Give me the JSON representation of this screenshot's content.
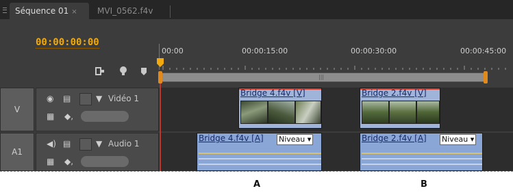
{
  "tabs": [
    {
      "label": "Séquence 01",
      "close": "×",
      "active": true
    },
    {
      "label": "MVI_0562.f4v",
      "active": false
    }
  ],
  "timecode": "00:00:00:00",
  "ruler": {
    "labels": [
      "00:00",
      "00:00:15:00",
      "00:00:30:00",
      "00:00:45:00"
    ]
  },
  "tracks": {
    "video": {
      "id": "V",
      "name": "Vidéo 1"
    },
    "audio": {
      "id": "A1",
      "name": "Audio 1"
    }
  },
  "clips": {
    "video_a": {
      "title": "Bridge 4.f4v [V]"
    },
    "video_b": {
      "title": "Bridge 2.f4v [V]"
    },
    "audio_a": {
      "title": "Bridge 4.f4v [A]",
      "param": "Niveau"
    },
    "audio_b": {
      "title": "Bridge 2.f4v [A]",
      "param": "Niveau"
    }
  },
  "captions": {
    "a": "A",
    "b": "B"
  },
  "colors": {
    "panel": "#3c3c3c",
    "timecode": "#f0a90e",
    "playhead": "#c0352a",
    "clip": "#9fb4d8"
  }
}
